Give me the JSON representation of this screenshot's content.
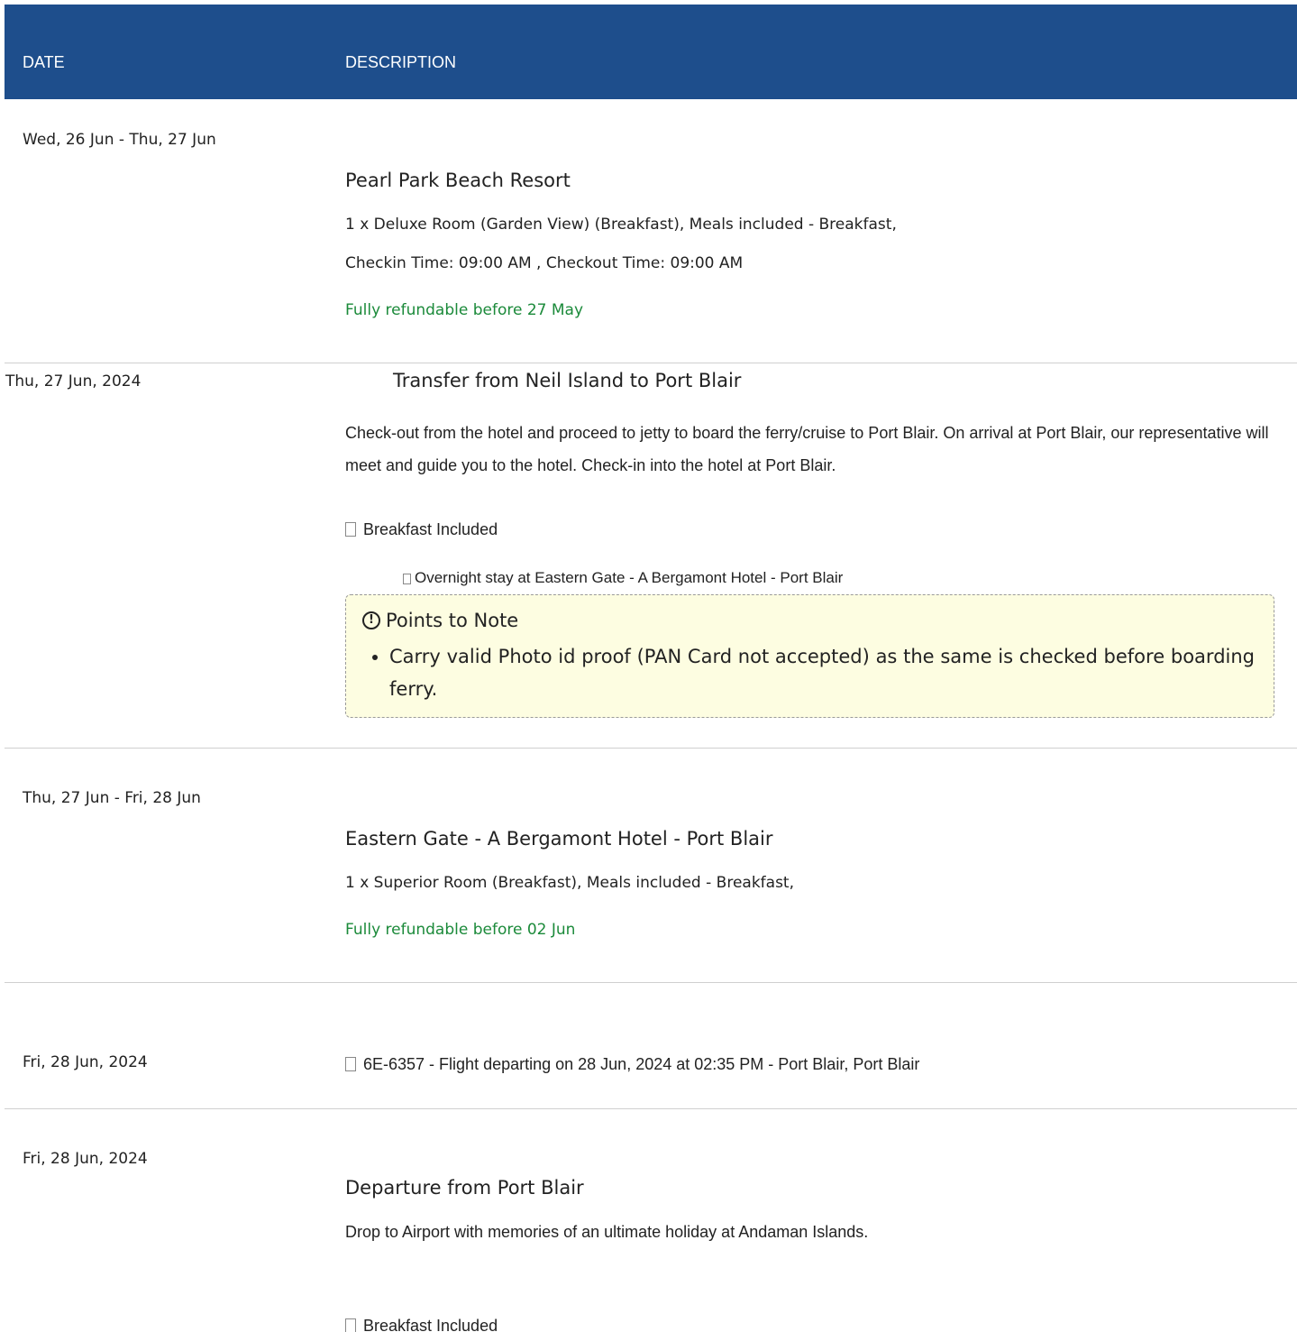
{
  "header": {
    "date_label": "DATE",
    "description_label": "DESCRIPTION"
  },
  "rows": [
    {
      "date": "Wed, 26 Jun - Thu, 27 Jun",
      "title": "Pearl Park Beach Resort",
      "room": "1 x Deluxe Room (Garden View) (Breakfast), Meals included - Breakfast,",
      "times": "Checkin Time: 09:00 AM , Checkout Time: 09:00 AM",
      "refund": "Fully refundable before 27 May"
    },
    {
      "date": "Thu, 27 Jun, 2024",
      "title": "Transfer from Neil Island to Port Blair",
      "description": "Check-out from the hotel and proceed to jetty to board the ferry/cruise to Port Blair. On arrival at Port Blair, our representative will meet and guide you to the hotel. Check-in into the hotel at Port Blair.",
      "meal": "Breakfast Included",
      "stay": "Overnight stay at Eastern Gate - A Bergamont Hotel - Port Blair",
      "note_title": "Points to Note",
      "note_items": [
        "Carry valid Photo id proof (PAN Card not accepted) as the same is checked before boarding ferry."
      ]
    },
    {
      "date": "Thu, 27 Jun - Fri, 28 Jun",
      "title": "Eastern Gate - A Bergamont Hotel - Port Blair",
      "room": "1 x Superior Room (Breakfast), Meals included - Breakfast,",
      "refund": "Fully refundable before 02 Jun"
    },
    {
      "date": "Fri, 28 Jun, 2024",
      "flight": "6E-6357 - Flight departing on 28 Jun, 2024 at 02:35 PM - Port Blair, Port Blair"
    },
    {
      "date": "Fri, 28 Jun, 2024",
      "title": "Departure from Port Blair",
      "description": "Drop to Airport with memories of an ultimate holiday at Andaman Islands.",
      "meal": "Breakfast Included"
    }
  ]
}
